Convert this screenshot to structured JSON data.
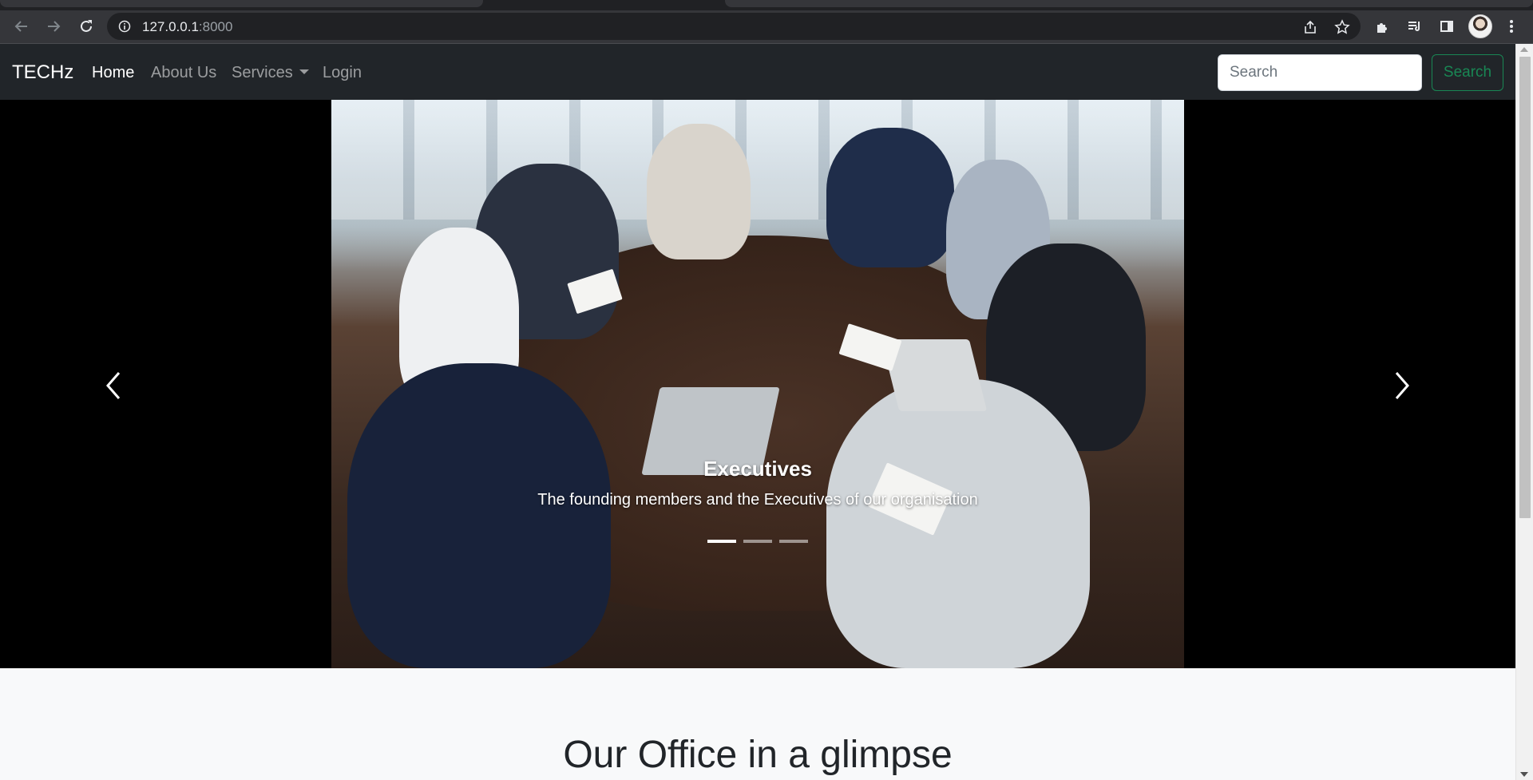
{
  "browser": {
    "url_host": "127.0.0.1",
    "url_port": ":8000",
    "icons": [
      "back-icon",
      "forward-icon",
      "reload-icon",
      "site-info-icon",
      "share-icon",
      "bookmark-star-icon",
      "extensions-icon",
      "media-queue-icon",
      "side-panel-icon",
      "profile-avatar",
      "menu-dots-icon"
    ]
  },
  "navbar": {
    "brand": "TECHz",
    "links": [
      {
        "label": "Home",
        "active": true
      },
      {
        "label": "About Us",
        "active": false
      },
      {
        "label": "Services",
        "active": false,
        "dropdown": true
      },
      {
        "label": "Login",
        "active": false
      }
    ],
    "search": {
      "placeholder": "Search",
      "button_label": "Search"
    },
    "colors": {
      "background": "#212529",
      "search_button": "#198754"
    }
  },
  "carousel": {
    "active_slide": 1,
    "slide_count": 3,
    "caption_title": "Executives",
    "caption_text": "The founding members and the Executives of our organisation",
    "prev_icon": "chevron-left-icon",
    "next_icon": "chevron-right-icon"
  },
  "section": {
    "title": "Our Office in a glimpse"
  }
}
